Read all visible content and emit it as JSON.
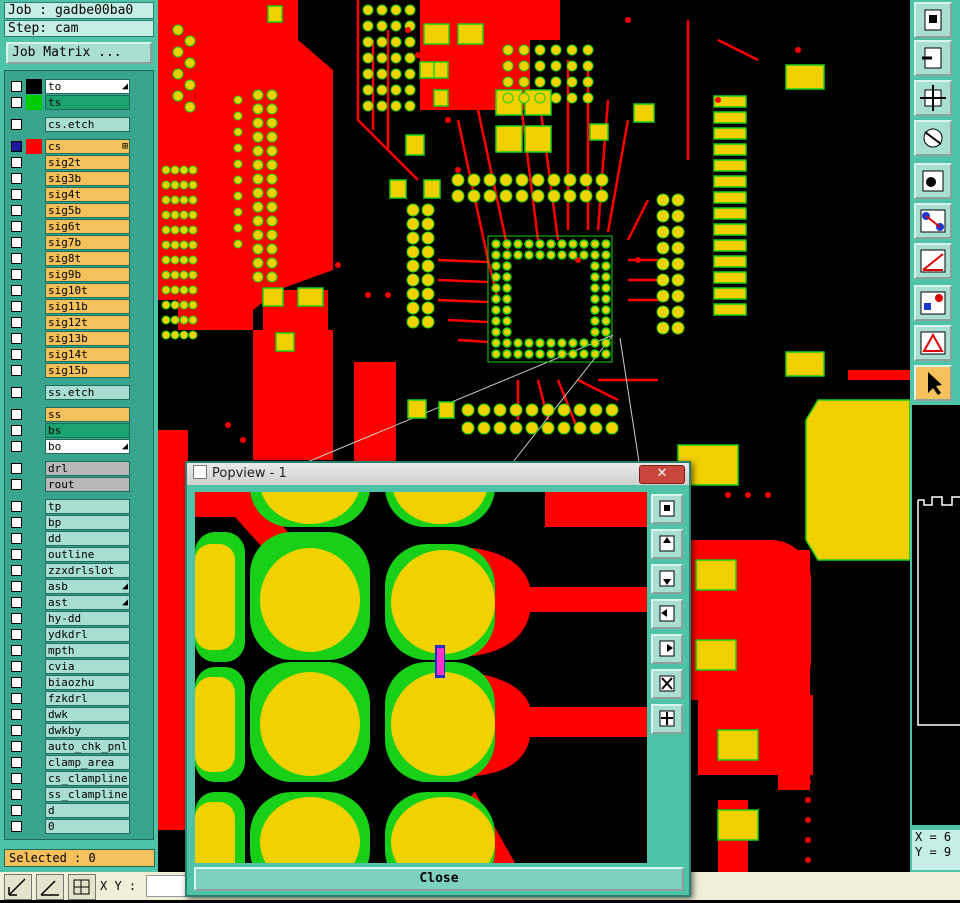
{
  "header": {
    "job": "Job : gadbe00ba0",
    "step": "Step: cam"
  },
  "job_matrix_label": "Job Matrix ...",
  "layers": [
    {
      "name": "to",
      "bg": "#ffffff",
      "swatch": "#000000",
      "mark": "◢"
    },
    {
      "name": "ts",
      "bg": "#1aa36e",
      "swatch": "#00cc00"
    },
    {
      "name": "cs.etch",
      "bg": "#a9ded3",
      "swatch": ""
    },
    {
      "name": "cs",
      "bg": "#f5c15b",
      "swatch": "#ff0000",
      "active": true,
      "mark": "⊞"
    },
    {
      "name": "sig2t",
      "bg": "#f5c15b"
    },
    {
      "name": "sig3b",
      "bg": "#f5c15b"
    },
    {
      "name": "sig4t",
      "bg": "#f5c15b"
    },
    {
      "name": "sig5b",
      "bg": "#f5c15b"
    },
    {
      "name": "sig6t",
      "bg": "#f5c15b"
    },
    {
      "name": "sig7b",
      "bg": "#f5c15b"
    },
    {
      "name": "sig8t",
      "bg": "#f5c15b"
    },
    {
      "name": "sig9b",
      "bg": "#f5c15b"
    },
    {
      "name": "sig10t",
      "bg": "#f5c15b"
    },
    {
      "name": "sig11b",
      "bg": "#f5c15b"
    },
    {
      "name": "sig12t",
      "bg": "#f5c15b"
    },
    {
      "name": "sig13b",
      "bg": "#f5c15b"
    },
    {
      "name": "sig14t",
      "bg": "#f5c15b"
    },
    {
      "name": "sig15b",
      "bg": "#f5c15b"
    },
    {
      "name": "ss.etch",
      "bg": "#a9ded3"
    },
    {
      "name": "ss",
      "bg": "#f5c15b"
    },
    {
      "name": "bs",
      "bg": "#1aa36e"
    },
    {
      "name": "bo",
      "bg": "#ffffff",
      "mark": "◢"
    },
    {
      "name": "drl",
      "bg": "#b8b8b8"
    },
    {
      "name": "rout",
      "bg": "#b8b8b8"
    },
    {
      "name": "tp",
      "bg": "#a9ded3"
    },
    {
      "name": "bp",
      "bg": "#a9ded3"
    },
    {
      "name": "dd",
      "bg": "#a9ded3"
    },
    {
      "name": "outline",
      "bg": "#a9ded3"
    },
    {
      "name": "zzxdrlslot",
      "bg": "#a9ded3"
    },
    {
      "name": "asb",
      "bg": "#a9ded3",
      "mark": "◢"
    },
    {
      "name": "ast",
      "bg": "#a9ded3",
      "mark": "◢"
    },
    {
      "name": "hy-dd",
      "bg": "#a9ded3"
    },
    {
      "name": "ydkdrl",
      "bg": "#a9ded3"
    },
    {
      "name": "mpth",
      "bg": "#a9ded3"
    },
    {
      "name": "cvia",
      "bg": "#a9ded3"
    },
    {
      "name": "biaozhu",
      "bg": "#a9ded3"
    },
    {
      "name": "fzkdrl",
      "bg": "#a9ded3"
    },
    {
      "name": "dwk",
      "bg": "#a9ded3"
    },
    {
      "name": "dwkby",
      "bg": "#a9ded3"
    },
    {
      "name": "auto_chk_pnl",
      "bg": "#a9ded3"
    },
    {
      "name": "clamp_area",
      "bg": "#a9ded3"
    },
    {
      "name": "cs_clampline",
      "bg": "#a9ded3"
    },
    {
      "name": "ss_clampline",
      "bg": "#a9ded3"
    },
    {
      "name": "d",
      "bg": "#a9ded3"
    },
    {
      "name": "0",
      "bg": "#a9ded3"
    }
  ],
  "selected": "Selected : 0",
  "xy_label": "X Y :",
  "coords": {
    "x": "X = 6",
    "y": "Y = 9"
  },
  "popview": {
    "title": "Popview - 1",
    "close_x": "✕",
    "close_label": "Close"
  },
  "colors": {
    "copper": "#ff0000",
    "pad": "#f2d100",
    "soldermask": "#19d019",
    "panel": "#4fc3a8",
    "marker": "#ff33cc"
  },
  "icons": {
    "right_toolbar": [
      "zoom-home-icon",
      "zoom-in-icon",
      "zoom-fit-icon",
      "snap-settings-icon",
      "select-feature-icon",
      "net-connect-icon",
      "measure-icon",
      "add-feature-icon",
      "drc-icon",
      "pointer-icon"
    ],
    "popview_toolbar": [
      "pop-menu-icon",
      "pan-up-icon",
      "pan-down-icon",
      "pan-left-icon",
      "pan-right-icon",
      "zoom-out-icon",
      "zoom-center-icon"
    ]
  }
}
